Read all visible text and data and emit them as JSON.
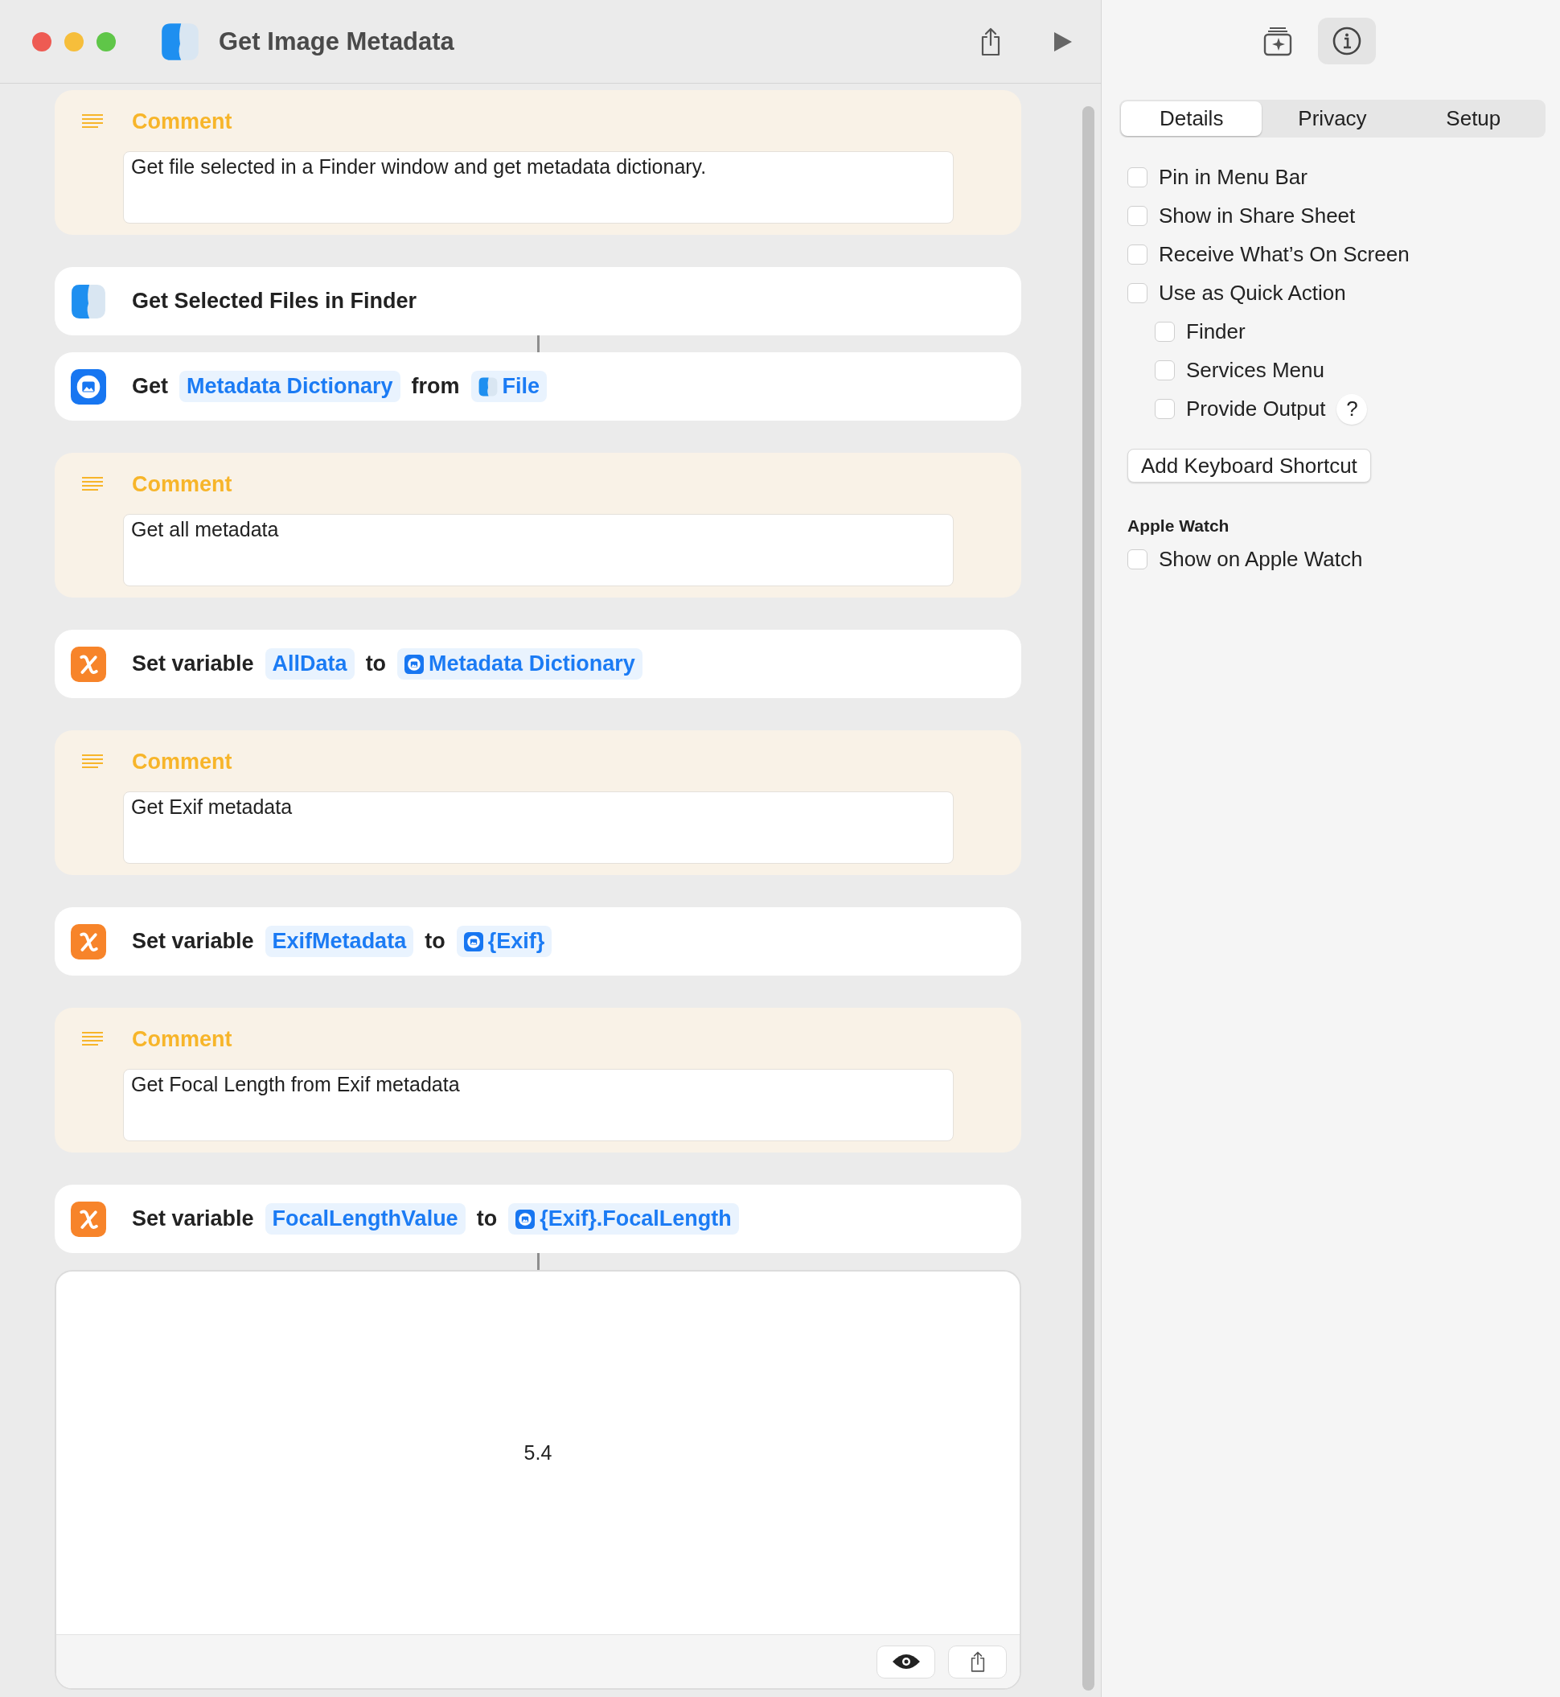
{
  "window": {
    "title": "Get Image Metadata"
  },
  "actions": [
    {
      "kind": "comment",
      "joined": false,
      "title": "Comment",
      "text": "Get file selected in a Finder window and get metadata dictionary."
    },
    {
      "kind": "finder_action",
      "joined": false,
      "parts": [
        {
          "kind": "label",
          "text": "Get Selected Files in Finder"
        }
      ]
    },
    {
      "kind": "image_action",
      "joined": true,
      "parts": [
        {
          "kind": "label",
          "text": "Get"
        },
        {
          "kind": "token",
          "text": "Metadata Dictionary"
        },
        {
          "kind": "label",
          "text": "from"
        },
        {
          "kind": "file_token",
          "text": "File"
        }
      ]
    },
    {
      "kind": "comment",
      "joined": false,
      "title": "Comment",
      "text": "Get all metadata"
    },
    {
      "kind": "variable_action",
      "joined": false,
      "parts": [
        {
          "kind": "label",
          "text": "Set variable"
        },
        {
          "kind": "token",
          "text": "AllData"
        },
        {
          "kind": "label",
          "text": "to"
        },
        {
          "kind": "data_token",
          "text": "Metadata Dictionary"
        }
      ]
    },
    {
      "kind": "comment",
      "joined": false,
      "title": "Comment",
      "text": "Get Exif metadata"
    },
    {
      "kind": "variable_action",
      "joined": false,
      "parts": [
        {
          "kind": "label",
          "text": "Set variable"
        },
        {
          "kind": "token",
          "text": "ExifMetadata"
        },
        {
          "kind": "label",
          "text": "to"
        },
        {
          "kind": "data_token",
          "text": "{Exif}"
        }
      ]
    },
    {
      "kind": "comment",
      "joined": false,
      "title": "Comment",
      "text": "Get Focal Length from Exif metadata"
    },
    {
      "kind": "variable_action",
      "joined": false,
      "parts": [
        {
          "kind": "label",
          "text": "Set variable"
        },
        {
          "kind": "token",
          "text": "FocalLengthValue"
        },
        {
          "kind": "label",
          "text": "to"
        },
        {
          "kind": "data_token",
          "text": "{Exif}.FocalLength"
        }
      ]
    },
    {
      "kind": "result",
      "joined": true,
      "value": "5.4"
    }
  ],
  "inspector": {
    "tabs": [
      {
        "label": "Details",
        "selected": true
      },
      {
        "label": "Privacy",
        "selected": false
      },
      {
        "label": "Setup",
        "selected": false
      }
    ],
    "options": [
      {
        "label": "Pin in Menu Bar",
        "checked": false
      },
      {
        "label": "Show in Share Sheet",
        "checked": false
      },
      {
        "label": "Receive What’s On Screen",
        "checked": false
      },
      {
        "label": "Use as Quick Action",
        "checked": false,
        "children": [
          {
            "label": "Finder",
            "checked": false
          },
          {
            "label": "Services Menu",
            "checked": false
          },
          {
            "label": "Provide Output",
            "checked": false,
            "help": "?"
          }
        ]
      }
    ],
    "shortcut_button": "Add Keyboard Shortcut",
    "section": "Apple Watch",
    "section_options": [
      {
        "label": "Show on Apple Watch",
        "checked": false
      }
    ]
  }
}
